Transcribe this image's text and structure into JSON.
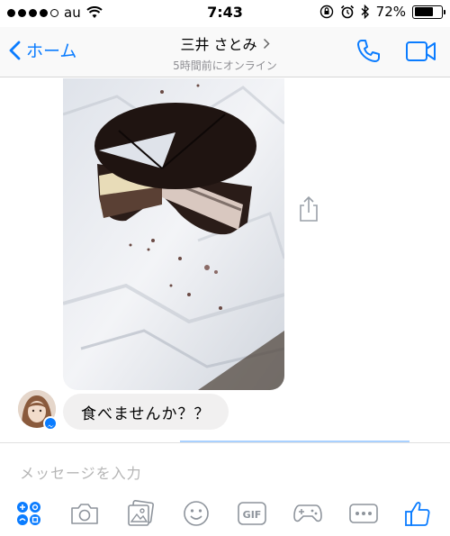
{
  "status_bar": {
    "carrier": "au",
    "time": "7:43",
    "battery_percent": "72%",
    "battery_level": 0.72,
    "signal_bars_filled": 4,
    "signal_bars_total": 5
  },
  "nav": {
    "back_label": "ホーム",
    "contact_name": "三井 さとみ",
    "contact_status": "5時間前にオンライン"
  },
  "messages": [
    {
      "type": "image",
      "icon": "cheesecake-photo"
    },
    {
      "type": "text",
      "text": "食べませんか？？"
    }
  ],
  "composer": {
    "placeholder": "メッセージを入力"
  },
  "toolbar": {
    "gif_label": "GIF",
    "icons": [
      "apps-icon",
      "camera-icon",
      "gallery-icon",
      "emoji-icon",
      "gif-icon",
      "game-icon",
      "more-icon",
      "like-icon"
    ]
  },
  "colors": {
    "accent": "#0a7cff",
    "bubble": "#f1f0f0",
    "placeholder": "#b5b5b5"
  }
}
